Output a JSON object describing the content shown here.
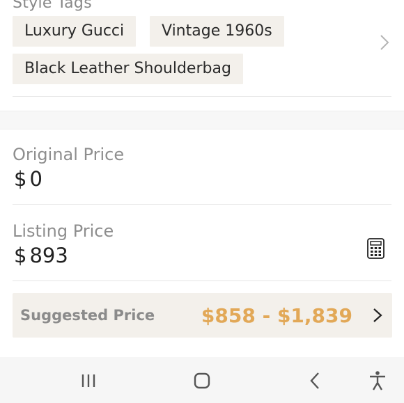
{
  "style_tags": {
    "title": "Style Tags",
    "tags": [
      "Luxury Gucci",
      "Vintage 1960s",
      "Black Leather Shoulderbag"
    ],
    "chevron_icon": "chevron-right-icon"
  },
  "original_price": {
    "label": "Original Price",
    "currency": "$",
    "value": "0"
  },
  "listing_price": {
    "label": "Listing Price",
    "currency": "$",
    "value": "893",
    "icon": "calculator-icon"
  },
  "suggested_price": {
    "label": "Suggested Price",
    "range": "$858 - $1,839",
    "accent_color": "#e2a857",
    "chevron_icon": "chevron-right-icon"
  },
  "nav_bar": {
    "buttons": [
      "recent-apps-icon",
      "home-icon",
      "back-icon",
      "accessibility-icon"
    ]
  }
}
